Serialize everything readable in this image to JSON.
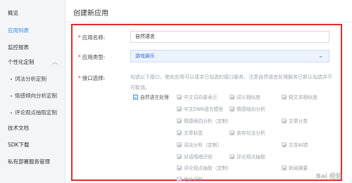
{
  "sidebar": {
    "items": [
      {
        "label": "概览"
      },
      {
        "label": "应用列表"
      },
      {
        "label": "监控报表"
      },
      {
        "label": "个性化定制"
      },
      {
        "label": "词法分析定制"
      },
      {
        "label": "情感倾向分析定制"
      },
      {
        "label": "评论观点抽取定制"
      },
      {
        "label": "技术文档"
      },
      {
        "label": "SDK下载"
      },
      {
        "label": "私有部署服务管理"
      }
    ]
  },
  "page": {
    "title": "创建新应用"
  },
  "form": {
    "name_label": "应用名称:",
    "name_value": "自然语言",
    "type_label": "应用类型:",
    "type_value": "游戏娱乐",
    "api_label": "接口选择:",
    "api_desc": "勾选以下接口，使此应用可以请求已勾选的接口服务，注意自然语言处理服务已默认勾选并不可取消。",
    "parent_group": "自然语言处理",
    "apis": [
      "中文词向量表示",
      "词义相似度",
      "短文本相似度",
      "中文DNN语言模型",
      "情感倾向分析",
      "情感倾向分析（定制）",
      "文章分类",
      "文章标签",
      "依存句法分析",
      "词法分析（定制）",
      "文本纠错",
      "对话情绪识别",
      "评论观点抽取",
      "评论观点抽取（定制）",
      "新闻摘要",
      "地址识别"
    ]
  },
  "watermark": "Bai 经验"
}
